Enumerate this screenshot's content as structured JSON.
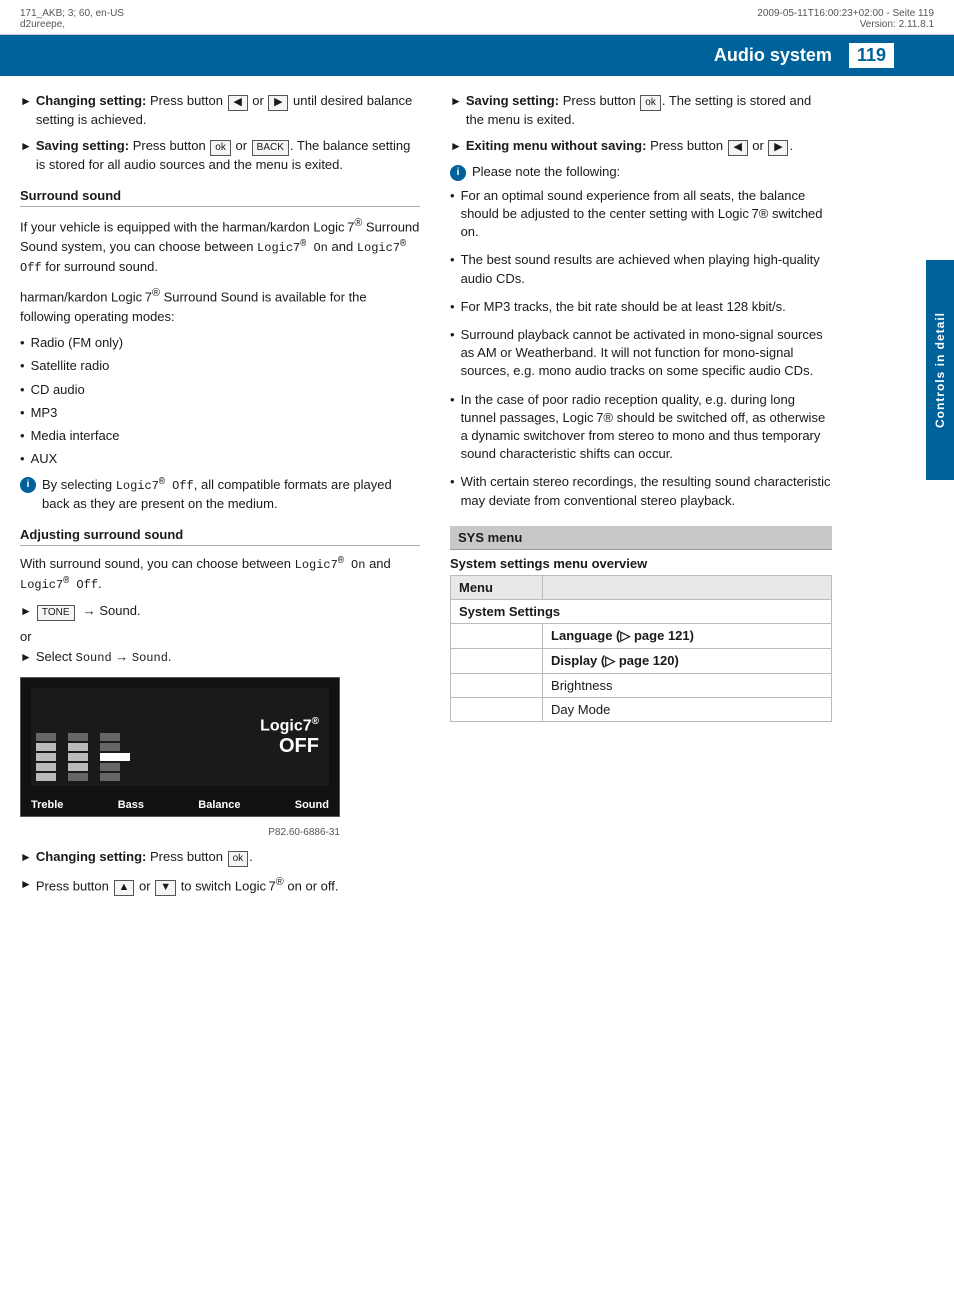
{
  "header": {
    "left_top": "171_AKB; 3; 60, en-US",
    "left_bottom": "d2ureepe,",
    "right_top": "2009-05-11T16:00:23+02:00 - Seite 119",
    "right_bottom": "Version: 2.11.8.1"
  },
  "title_bar": {
    "title": "Audio system",
    "page_number": "119"
  },
  "sidebar_tab": "Controls in detail",
  "left_column": {
    "changing_setting_1": {
      "label": "Changing setting:",
      "text": "Press button"
    },
    "changing_setting_1b": "or",
    "changing_setting_1c": "until desired balance setting is achieved.",
    "saving_setting_1": {
      "label": "Saving setting:",
      "text": "Press button"
    },
    "saving_setting_1b": "or",
    "saving_setting_1c": ". The balance setting is stored for all audio sources and the menu is exited.",
    "surround_sound_title": "Surround sound",
    "surround_para1": "If your vehicle is equipped with the harman/kardon Logic 7® Surround Sound system, you can choose between",
    "logic7_on": "Logic7® On",
    "and": "and",
    "logic7_off": "Logic7® Off",
    "surround_para1c": "for surround sound.",
    "surround_para2": "harman/kardon Logic 7® Surround Sound is available for the following operating modes:",
    "bullets": [
      "Radio (FM only)",
      "Satellite radio",
      "CD audio",
      "MP3",
      "Media interface",
      "AUX"
    ],
    "info_box": {
      "icon": "i",
      "text": "By selecting Logic7® Off, all compatible formats are played back as they are present on the medium."
    },
    "adj_surround_title": "Adjusting surround sound",
    "adj_surround_para": "With surround sound, you can choose between Logic7® On and Logic7® Off.",
    "tone_arrow": "TONE → Sound.",
    "or_text": "or",
    "select_arrow": "Select Sound → Sound.",
    "device_caption": "P82.60-6886-31",
    "device_labels": [
      "Treble",
      "Bass",
      "Balance",
      "Sound"
    ],
    "device_logic7": "Logic7®",
    "device_off": "OFF",
    "changing_setting_2": {
      "label": "Changing setting:",
      "text": "Press button"
    },
    "press_button_switch": "Press button",
    "or_text2": "or",
    "to_switch": "to switch Logic 7® on or off."
  },
  "right_column": {
    "saving_setting_r": {
      "label": "Saving setting:",
      "text": "Press button"
    },
    "saving_r_b": ". The setting is stored and the menu is exited.",
    "exiting_menu": {
      "label": "Exiting menu without saving:",
      "text": "Press button"
    },
    "exiting_b": "or",
    "please_note": "Please note the following:",
    "notes": [
      "For an optimal sound experience from all seats, the balance should be adjusted to the center setting with Logic 7® switched on.",
      "The best sound results are achieved when playing high-quality audio CDs.",
      "For MP3 tracks, the bit rate should be at least 128 kbit/s.",
      "Surround playback cannot be activated in mono-signal sources as AM or Weatherband. It will not function for mono-signal sources, e.g. mono audio tracks on some specific audio CDs.",
      "In the case of poor radio reception quality, e.g. during long tunnel passages, Logic 7® should be switched off, as otherwise a dynamic switchover from stereo to mono and thus temporary sound characteristic shifts can occur.",
      "With certain stereo recordings, the resulting sound characteristic may deviate from conventional stereo playback."
    ],
    "sys_menu_title": "SYS menu",
    "sys_menu_subtitle": "System settings menu overview",
    "table": {
      "headers": [
        "Menu",
        ""
      ],
      "rows": [
        {
          "col1": "System Settings",
          "col2": "",
          "type": "header"
        },
        {
          "col1": "",
          "col2": "Language (▷ page 121)",
          "type": "sub"
        },
        {
          "col1": "",
          "col2": "Display (▷ page 120)",
          "type": "sub"
        },
        {
          "col1": "",
          "col2": "Brightness",
          "type": "sub"
        },
        {
          "col1": "",
          "col2": "Day Mode",
          "type": "sub"
        }
      ]
    }
  }
}
